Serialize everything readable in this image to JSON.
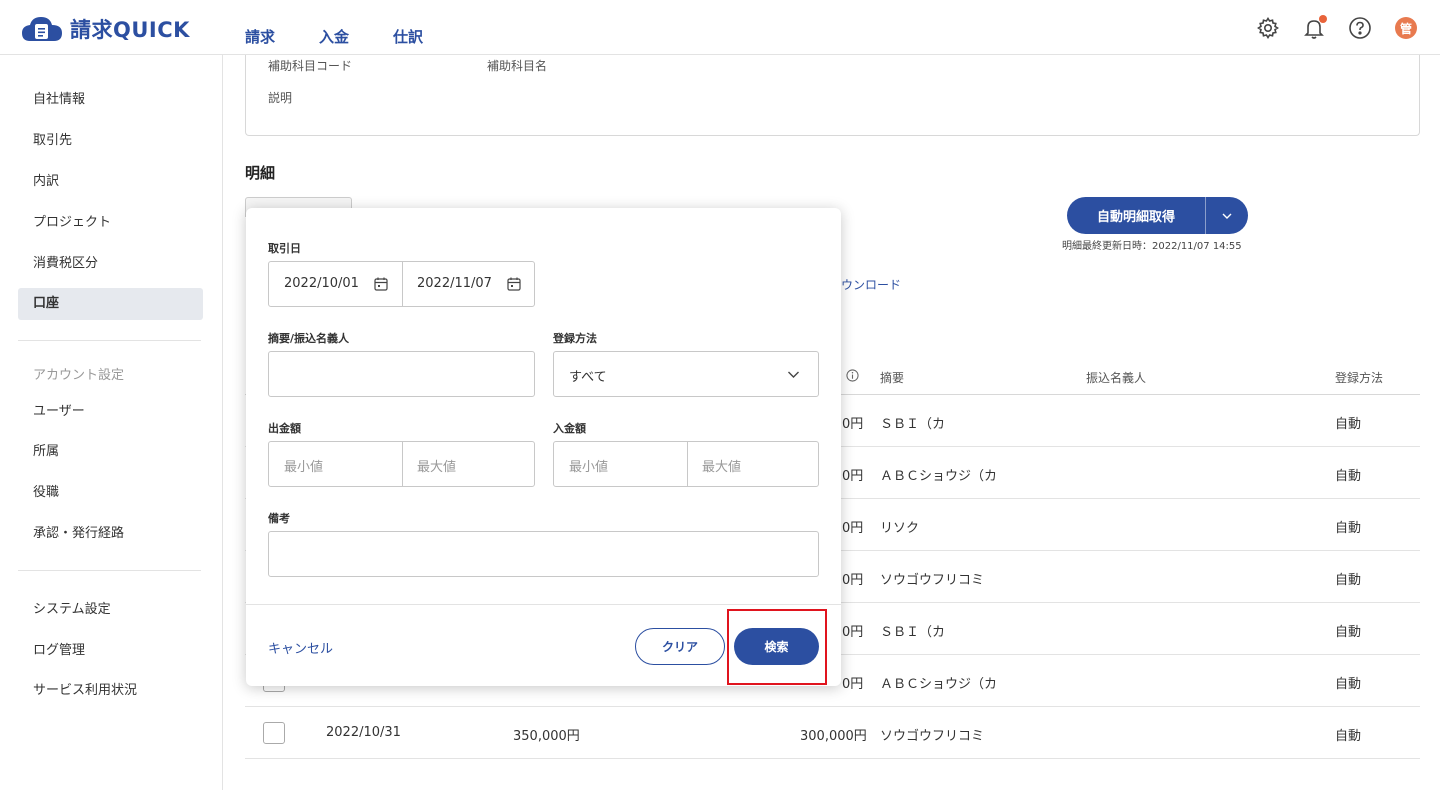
{
  "header": {
    "logo_text": "請求QUICK",
    "nav": [
      "請求",
      "入金",
      "仕訳"
    ],
    "avatar_text": "管",
    "icons": [
      "settings-gear-icon",
      "notification-bell-icon",
      "help-icon"
    ],
    "accent_color": "#2c4fa1"
  },
  "sidebar": {
    "items_primary": [
      "自社情報",
      "取引先",
      "内訳",
      "プロジェクト",
      "消費税区分",
      "口座"
    ],
    "active_item": "口座",
    "account_heading": "アカウント設定",
    "items_account": [
      "ユーザー",
      "所属",
      "役職",
      "承認・発行経路"
    ],
    "items_system": [
      "システム設定",
      "ログ管理",
      "サービス利用状況"
    ]
  },
  "top_card": {
    "code_label": "補助科目コード",
    "name_label": "補助科目名",
    "description_label": "説明"
  },
  "details": {
    "title": "明細",
    "auto_fetch_button": "自動明細取得",
    "last_updated": "明細最終更新日時：2022/11/07 14:55",
    "download_link": "ウンロード"
  },
  "table": {
    "headers": {
      "summary": "摘要",
      "payer_name": "振込名義人",
      "registration_method": "登録方法"
    },
    "rows": [
      {
        "amount_tail": "0円",
        "summary": "ＳＢＩ（カ",
        "method": "自動"
      },
      {
        "amount_tail": "0円",
        "summary": "ＡＢＣショウジ（カ",
        "method": "自動"
      },
      {
        "amount_tail": "0円",
        "summary": "リソク",
        "method": "自動"
      },
      {
        "amount_tail": "0円",
        "summary": "ソウゴウフリコミ",
        "method": "自動"
      },
      {
        "amount_tail": "0円",
        "summary": "ＳＢＩ（カ",
        "method": "自動"
      },
      {
        "amount_tail": "0円",
        "summary": "ＡＢＣショウジ（カ",
        "method": "自動"
      }
    ],
    "last_row": {
      "date": "2022/10/31",
      "withdrawal": "350,000円",
      "deposit": "300,000円",
      "summary": "ソウゴウフリコミ",
      "method": "自動"
    }
  },
  "filter_modal": {
    "date_label": "取引日",
    "date_from": "2022/10/01",
    "date_to": "2022/11/07",
    "summary_label": "摘要/振込名義人",
    "summary_value": "",
    "method_label": "登録方法",
    "method_value": "すべて",
    "withdrawal_label": "出金額",
    "deposit_label": "入金額",
    "min_placeholder": "最小値",
    "max_placeholder": "最大値",
    "note_label": "備考",
    "note_value": "",
    "cancel": "キャンセル",
    "clear": "クリア",
    "search": "検索"
  }
}
